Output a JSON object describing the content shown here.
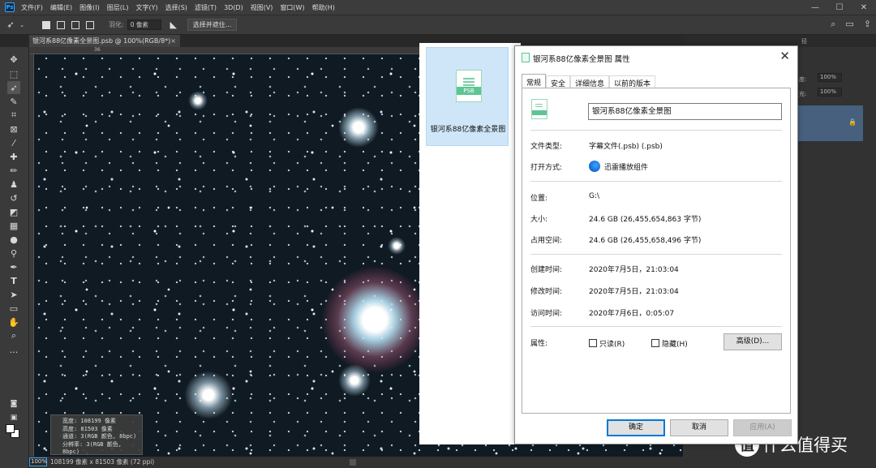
{
  "menubar": {
    "logo": "Ps",
    "items": [
      "文件(F)",
      "编辑(E)",
      "图像(I)",
      "图层(L)",
      "文字(Y)",
      "选择(S)",
      "滤镜(T)",
      "3D(D)",
      "视图(V)",
      "窗口(W)",
      "帮助(H)"
    ]
  },
  "options": {
    "feather_label": "羽化:",
    "feather_value": "0 像素",
    "select_mask_button": "选择并遮住..."
  },
  "document_tab": {
    "title": "银河系88亿像素全景图.psb @ 100%(RGB/8*)",
    "close": "×"
  },
  "ruler": {
    "top_mark": "36"
  },
  "canvas_info": {
    "lines": [
      "宽度: 108199 像素",
      "高度: 81503 像素",
      "通道: 3(RGB 颜色, 8bpc)",
      "分辨率: 3(RGB 颜色, 8bpc)"
    ]
  },
  "statusbar": {
    "zoom": "100%",
    "doc_info": "108199 像素 x 81503 像素 (72 ppi)"
  },
  "right_panel": {
    "tab_label": "径",
    "opacity_label": "度:",
    "opacity_value": "100%",
    "fill_label": "充:",
    "fill_value": "100%"
  },
  "watermark": {
    "logo": "值",
    "text": "什么值得买"
  },
  "explorer": {
    "file_icon_label": "PSB",
    "file_name": "银河系88亿像素全景图"
  },
  "dialog": {
    "title": "银河系88亿像素全景图 属性",
    "tabs": [
      "常规",
      "安全",
      "详细信息",
      "以前的版本"
    ],
    "name_value": "银河系88亿像素全景图",
    "file_type_label": "文件类型:",
    "file_type_value": "字幕文件(.psb) (.psb)",
    "open_with_label": "打开方式:",
    "open_with_value": "迅雷播放组件",
    "location_label": "位置:",
    "location_value": "G:\\",
    "size_label": "大小:",
    "size_value": "24.6 GB (26,455,654,863 字节)",
    "disk_size_label": "占用空间:",
    "disk_size_value": "24.6 GB (26,455,658,496 字节)",
    "created_label": "创建时间:",
    "created_value": "2020年7月5日，21:03:04",
    "modified_label": "修改时间:",
    "modified_value": "2020年7月5日，21:03:04",
    "accessed_label": "访问时间:",
    "accessed_value": "2020年7月6日，0:05:07",
    "attributes_label": "属性:",
    "readonly_label": "只读(R)",
    "hidden_label": "隐藏(H)",
    "advanced_button": "高级(D)...",
    "ok_button": "确定",
    "cancel_button": "取消",
    "apply_button": "应用(A)"
  }
}
